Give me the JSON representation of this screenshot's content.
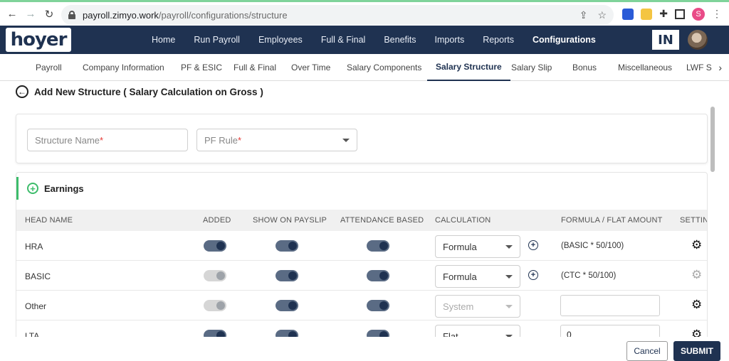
{
  "browser": {
    "url_host": "payroll.zimyo.work",
    "url_path": "/payroll/configurations/structure",
    "profile_initial": "S"
  },
  "header": {
    "logo_text": "hoyer",
    "nav": [
      "Home",
      "Run Payroll",
      "Employees",
      "Full & Final",
      "Benefits",
      "Imports",
      "Reports",
      "Configurations"
    ],
    "active_nav": "Configurations",
    "country_badge": "IN"
  },
  "subnav": {
    "tabs": [
      "Payroll",
      "Company Information",
      "PF & ESIC",
      "Full & Final",
      "Over Time",
      "Salary Components",
      "Salary Structure",
      "Salary Slip",
      "Bonus",
      "Miscellaneous",
      "LWF S"
    ],
    "active": "Salary Structure"
  },
  "page": {
    "title": "Add New Structure ( Salary Calculation on Gross )"
  },
  "form": {
    "structure_name_placeholder": "Structure Name",
    "pf_rule_placeholder": "PF Rule",
    "required_mark": "*"
  },
  "earnings": {
    "title": "Earnings",
    "columns": [
      "HEAD NAME",
      "ADDED",
      "SHOW ON PAYSLIP",
      "ATTENDANCE BASED",
      "CALCULATION",
      "FORMULA / FLAT AMOUNT",
      "SETTING"
    ],
    "rows": [
      {
        "head": "HRA",
        "added": true,
        "added_disabled": false,
        "show_on_payslip": true,
        "attendance_based": true,
        "calculation": "Formula",
        "calc_disabled": false,
        "formula": "(BASIC * 50/100)",
        "setting_disabled": false
      },
      {
        "head": "BASIC",
        "added": true,
        "added_disabled": true,
        "show_on_payslip": true,
        "attendance_based": true,
        "calculation": "Formula",
        "calc_disabled": false,
        "formula": "(CTC * 50/100)",
        "setting_disabled": true
      },
      {
        "head": "Other",
        "added": true,
        "added_disabled": true,
        "show_on_payslip": true,
        "attendance_based": true,
        "calculation": "System",
        "calc_disabled": true,
        "formula": "",
        "setting_disabled": false
      },
      {
        "head": "LTA",
        "added": true,
        "added_disabled": false,
        "show_on_payslip": true,
        "attendance_based": true,
        "calculation": "Flat",
        "calc_disabled": false,
        "formula": "0",
        "setting_disabled": false
      }
    ]
  },
  "footer": {
    "cancel_label": "Cancel",
    "submit_label": "SUBMIT"
  },
  "colors": {
    "primary": "#1f3251",
    "accent_green": "#3dbc6b",
    "required": "#e53935"
  }
}
